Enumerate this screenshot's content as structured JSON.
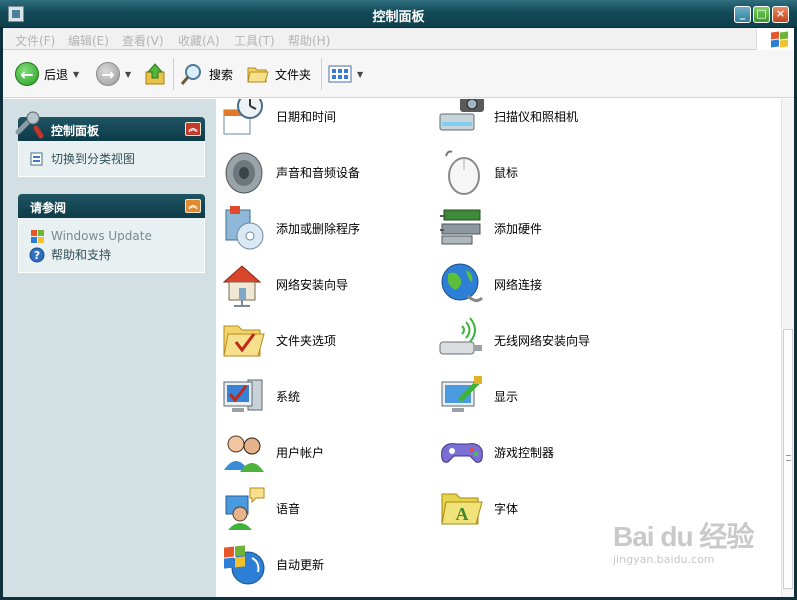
{
  "window": {
    "title": "控制面板"
  },
  "menubar": {
    "items": [
      "文件(F)",
      "编辑(E)",
      "查看(V)",
      "收藏(A)",
      "工具(T)",
      "帮助(H)"
    ]
  },
  "toolbar": {
    "back_label": "后退",
    "search_label": "搜索",
    "folders_label": "文件夹"
  },
  "sidebar": {
    "control_panel_title": "控制面板",
    "switch_view_label": "切换到分类视图",
    "see_also_title": "请参阅",
    "see_also_links": [
      "Windows Update",
      "帮助和支持"
    ]
  },
  "items": [
    {
      "label": "日期和时间",
      "icon": "clock-calendar-icon"
    },
    {
      "label": "扫描仪和照相机",
      "icon": "scanner-camera-icon"
    },
    {
      "label": "声音和音频设备",
      "icon": "speaker-icon"
    },
    {
      "label": "鼠标",
      "icon": "mouse-icon"
    },
    {
      "label": "添加或删除程序",
      "icon": "add-remove-programs-icon"
    },
    {
      "label": "添加硬件",
      "icon": "hardware-icon"
    },
    {
      "label": "网络安装向导",
      "icon": "home-network-icon"
    },
    {
      "label": "网络连接",
      "icon": "globe-network-icon"
    },
    {
      "label": "文件夹选项",
      "icon": "folder-check-icon"
    },
    {
      "label": "无线网络安装向导",
      "icon": "wireless-icon"
    },
    {
      "label": "系统",
      "icon": "computer-icon"
    },
    {
      "label": "显示",
      "icon": "display-icon"
    },
    {
      "label": "用户帐户",
      "icon": "users-icon"
    },
    {
      "label": "游戏控制器",
      "icon": "gamepad-icon"
    },
    {
      "label": "语音",
      "icon": "speech-icon"
    },
    {
      "label": "字体",
      "icon": "fonts-folder-icon"
    },
    {
      "label": "自动更新",
      "icon": "windows-update-icon"
    }
  ],
  "watermark": {
    "brand": "Bai du 经验",
    "url": "jingyan.baidu.com"
  }
}
